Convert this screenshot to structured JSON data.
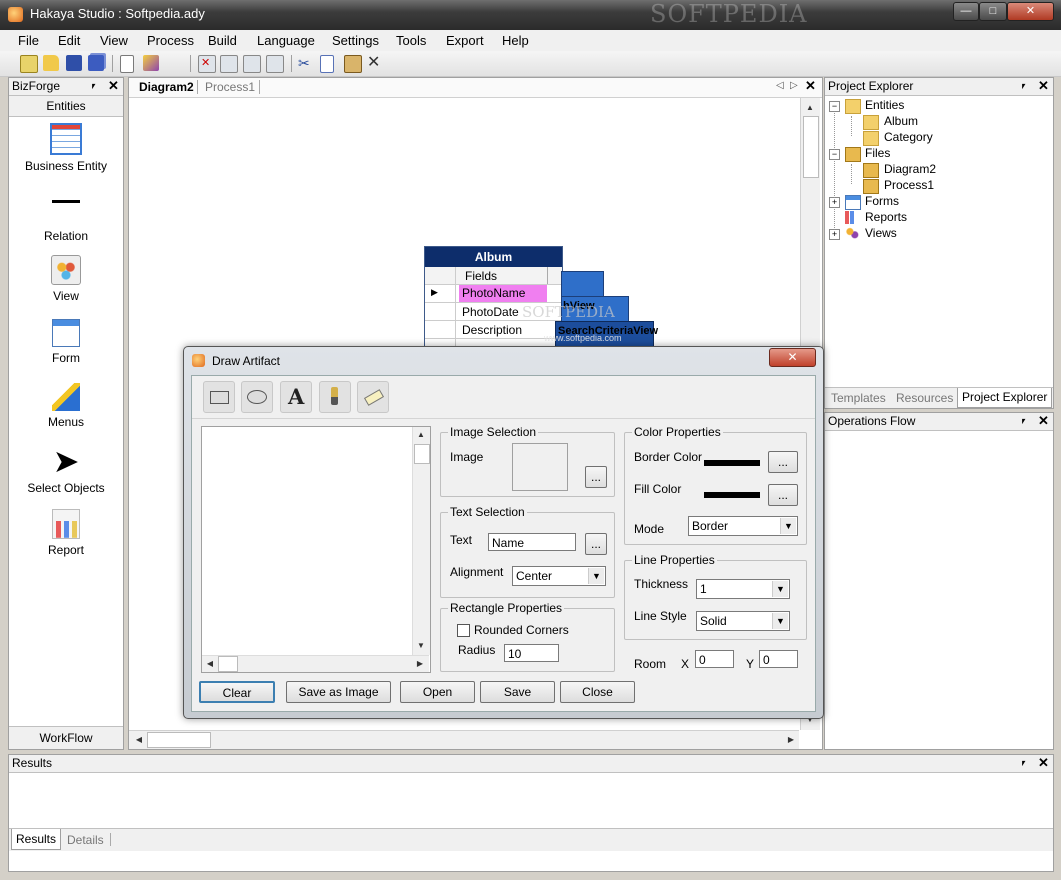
{
  "window": {
    "title": "Hakaya Studio : Softpedia.ady",
    "watermark": "SOFTPEDIA"
  },
  "menu": [
    "File",
    "Edit",
    "View",
    "Process",
    "Build",
    "Language",
    "Settings",
    "Tools",
    "Export",
    "Help"
  ],
  "bizforge": {
    "title": "BizForge",
    "section": "Entities",
    "tools": [
      "Business Entity",
      "Relation",
      "View",
      "Form",
      "Menus",
      "Select Objects",
      "Report"
    ],
    "footer": "WorkFlow"
  },
  "doc_tabs": [
    "Diagram2",
    "Process1"
  ],
  "diagram": {
    "entity_title": "Album",
    "header": "Fields",
    "fields": [
      "PhotoName",
      "PhotoDate",
      "Description"
    ],
    "partial_labels": [
      "hView",
      "SearchCriteriaView"
    ],
    "watermark": "SOFTPEDIA",
    "watermark_url": "www.softpedia.com"
  },
  "project_explorer": {
    "title": "Project Explorer",
    "tree": [
      {
        "label": "Entities",
        "children": [
          "Album",
          "Category"
        ]
      },
      {
        "label": "Files",
        "children": [
          "Diagram2",
          "Process1"
        ]
      },
      {
        "label": "Forms",
        "children": []
      },
      {
        "label": "Reports",
        "children": []
      },
      {
        "label": "Views",
        "children": []
      }
    ],
    "tabs": [
      "Templates",
      "Resources",
      "Project Explorer"
    ]
  },
  "operations_flow": {
    "title": "Operations Flow"
  },
  "results": {
    "title": "Results",
    "tabs": [
      "Results",
      "Details"
    ]
  },
  "dialog": {
    "title": "Draw Artifact",
    "image_selection": {
      "legend": "Image Selection",
      "image_label": "Image",
      "browse": "..."
    },
    "text_selection": {
      "legend": "Text Selection",
      "text_label": "Text",
      "text_value": "Name",
      "browse": "...",
      "alignment_label": "Alignment",
      "alignment_value": "Center"
    },
    "rectangle": {
      "legend": "Rectangle Properties",
      "rounded_label": "Rounded Corners",
      "rounded_checked": false,
      "radius_label": "Radius",
      "radius_value": "10"
    },
    "color": {
      "legend": "Color Properties",
      "border_label": "Border Color",
      "fill_label": "Fill Color",
      "mode_label": "Mode",
      "mode_value": "Border",
      "browse": "...",
      "border_color": "#000000",
      "fill_color": "#000000"
    },
    "line": {
      "legend": "Line Properties",
      "thickness_label": "Thickness",
      "thickness_value": "1",
      "style_label": "Line Style",
      "style_value": "Solid"
    },
    "room": {
      "label": "Room",
      "x_label": "X",
      "x_value": "0",
      "y_label": "Y",
      "y_value": "0"
    },
    "buttons": [
      "Clear",
      "Save as Image",
      "Open",
      "Save",
      "Close"
    ]
  }
}
